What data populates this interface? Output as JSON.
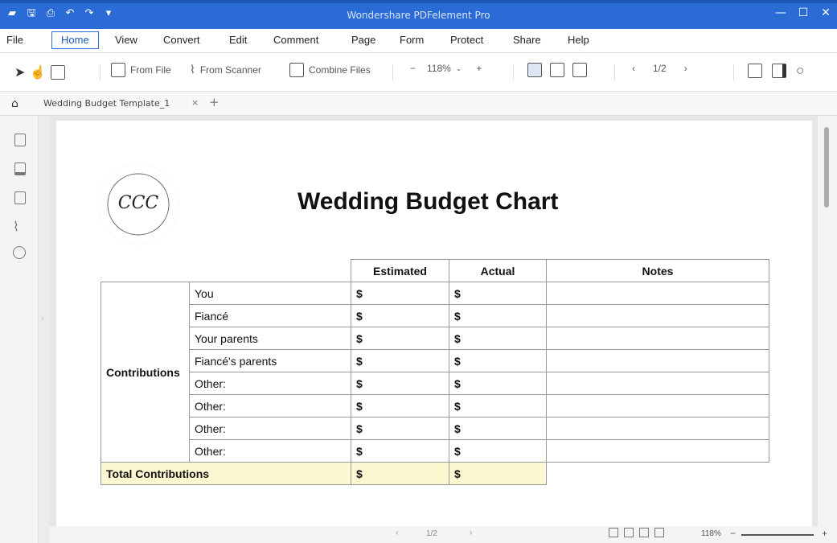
{
  "window": {
    "title": "Wondershare PDFelement Pro",
    "minimize": "—",
    "maximize": "☐",
    "close": "✕"
  },
  "menu": {
    "items": [
      "File",
      "Home",
      "View",
      "Convert",
      "Edit",
      "Comment",
      "Page",
      "Form",
      "Protect",
      "Share",
      "Help"
    ],
    "active": "Home"
  },
  "toolbar": {
    "from_file": "From File",
    "from_scanner": "From Scanner",
    "combine_files": "Combine Files",
    "zoom_minus": "−",
    "zoom_value": "118%",
    "zoom_plus": "+",
    "page_indicator": "1/2",
    "prev": "‹",
    "next": "›"
  },
  "tabs": {
    "active_tab": "Wedding Budget Template_1",
    "close": "×",
    "add": "+"
  },
  "document": {
    "title": "Wedding Budget Chart",
    "logo_monogram": "CCC",
    "logo_text": "CONSUMER CREDIT COUNSELING SERVICE · SAN FRANCISCO",
    "headers": [
      "Estimated",
      "Actual",
      "Notes"
    ],
    "group_label": "Contributions",
    "rows": [
      "You",
      "Fiancé",
      "Your parents",
      "Fiancé's parents",
      "Other:",
      "Other:",
      "Other:",
      "Other:"
    ],
    "dollar": "$",
    "total_label": "Total Contributions"
  },
  "status": {
    "page": "1/2",
    "zoom": "118%",
    "minus": "−",
    "plus": "+"
  }
}
